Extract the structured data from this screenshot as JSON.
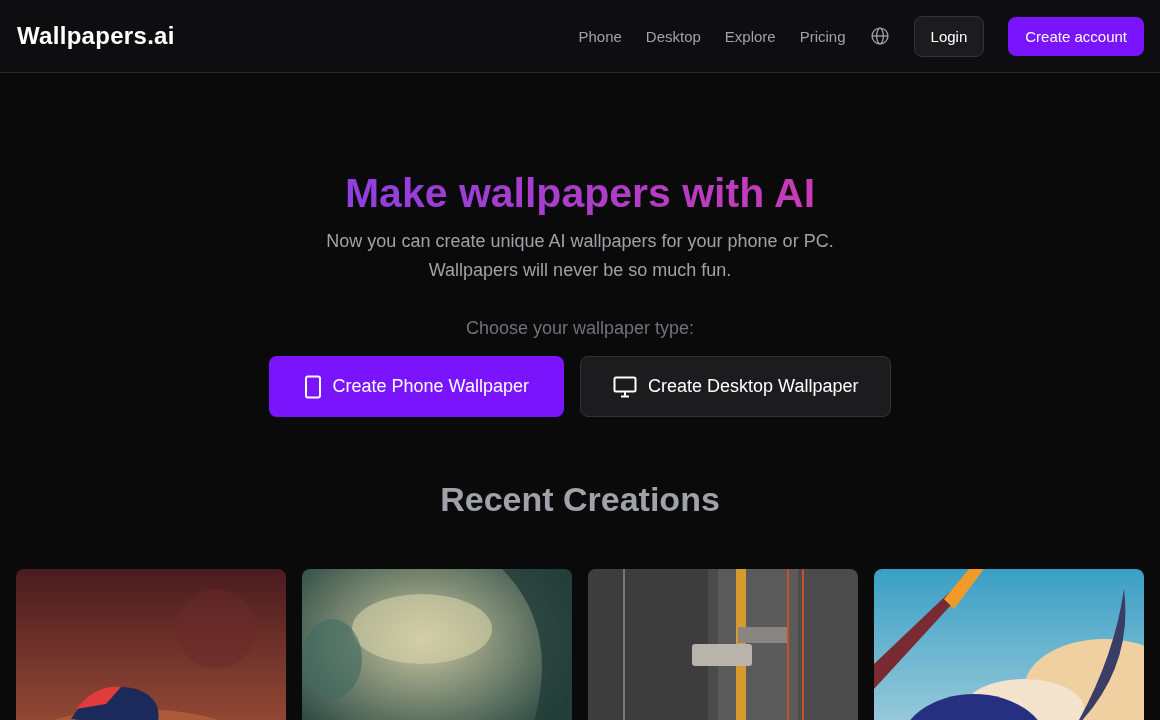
{
  "header": {
    "logo": "Wallpapers.ai",
    "nav": [
      "Phone",
      "Desktop",
      "Explore",
      "Pricing"
    ],
    "buttons": [
      {
        "label": "Login",
        "primary": false
      },
      {
        "label": "Create account",
        "primary": true
      }
    ]
  },
  "hero": {
    "title": "Make wallpapers with AI",
    "subtitle": [
      "Now you can create unique AI wallpapers for your phone or PC.",
      "Wallpapers will never be so much fun."
    ],
    "prompt": "Choose your wallpaper type:",
    "options": [
      {
        "kind": "phone",
        "label": "Create Phone Wallpaper",
        "primary": true
      },
      {
        "kind": "desktop",
        "label": "Create Desktop Wallpaper",
        "primary": false
      }
    ]
  },
  "recent_creations": {
    "title": "Recent Creations"
  }
}
